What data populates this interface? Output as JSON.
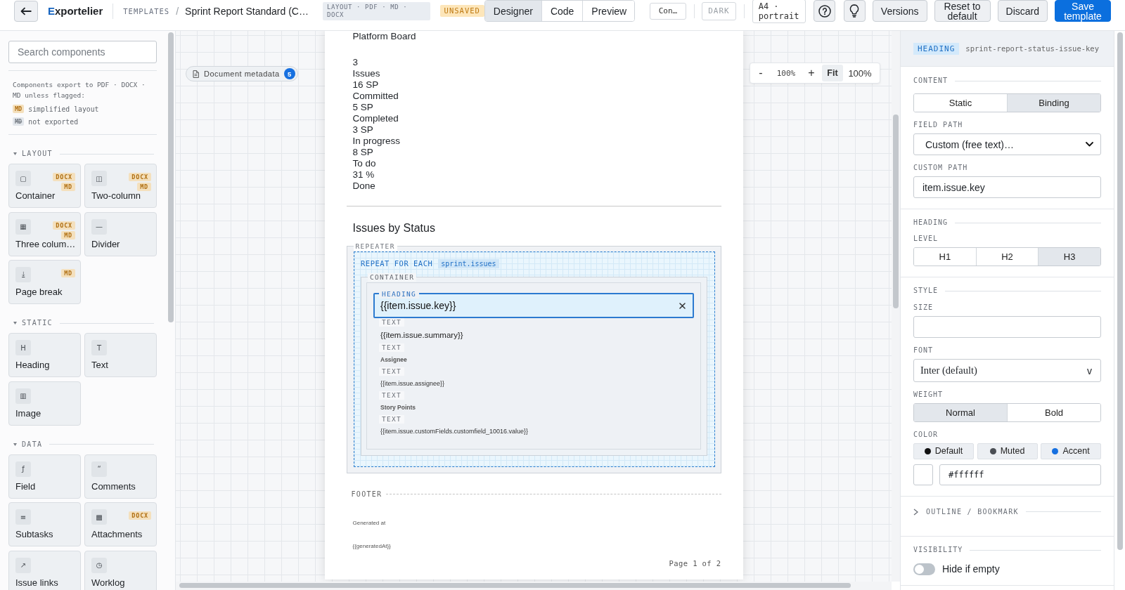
{
  "top_bar": {
    "brand": "Exportelier",
    "breadcrumb": {
      "section": "TEMPLATES",
      "separator": "/",
      "title": "Sprint Report Standard (C…"
    },
    "formats_badge": "LAYOUT · PDF · MD · DOCX",
    "status_badge": "UNSAVED",
    "view_tabs": [
      {
        "label": "Designer",
        "selected": true
      },
      {
        "label": "Code",
        "selected": false
      },
      {
        "label": "Preview",
        "selected": false
      }
    ],
    "context_button": "Con…",
    "theme_toggle": {
      "label": "DARK",
      "on": false
    },
    "page_format": "A4 · portrait",
    "actions": [
      {
        "label": "Versions",
        "kind": "secondary"
      },
      {
        "label": "Reset to default",
        "kind": "secondary"
      },
      {
        "label": "Discard",
        "kind": "secondary"
      },
      {
        "label": "Save template",
        "kind": "primary"
      }
    ]
  },
  "sidebar": {
    "search": {
      "placeholder": "Search components"
    },
    "legend": {
      "note": "Components export to PDF · DOCX · MD unless flagged:",
      "items": [
        {
          "badge": "MD",
          "label": "simplified layout",
          "kind": "simplified"
        },
        {
          "badge": "MD",
          "label": "not exported",
          "kind": "excluded"
        }
      ]
    },
    "groups": [
      {
        "title": "LAYOUT",
        "expanded": true,
        "items": [
          {
            "label": "Container",
            "icon": "▢",
            "flags": [
              "DOCX",
              "MD"
            ]
          },
          {
            "label": "Two-column",
            "icon": "◫",
            "flags": [
              "DOCX",
              "MD"
            ]
          },
          {
            "label": "Three colum…",
            "icon": "▦",
            "flags": [
              "DOCX",
              "MD"
            ]
          },
          {
            "label": "Divider",
            "icon": "—"
          },
          {
            "label": "Page break",
            "icon": "⤓",
            "flags": [
              "MD"
            ]
          }
        ]
      },
      {
        "title": "STATIC",
        "expanded": true,
        "items": [
          {
            "label": "Heading",
            "icon": "H"
          },
          {
            "label": "Text",
            "icon": "T"
          },
          {
            "label": "Image",
            "icon": "▥"
          }
        ]
      },
      {
        "title": "DATA",
        "expanded": true,
        "items": [
          {
            "label": "Field",
            "icon": "ƒ"
          },
          {
            "label": "Comments",
            "icon": "“"
          },
          {
            "label": "Subtasks",
            "icon": "≡"
          },
          {
            "label": "Attachments",
            "icon": "▩",
            "flags": [
              "DOCX"
            ]
          },
          {
            "label": "Issue links",
            "icon": "↗"
          },
          {
            "label": "Worklog",
            "icon": "◷"
          }
        ]
      }
    ]
  },
  "canvas": {
    "metadata_chip": {
      "label": "Document metadata",
      "count": "5"
    },
    "zoom": {
      "zoom_out": "-",
      "level": "100%",
      "zoom_in": "+",
      "modes": [
        {
          "label": "Fit",
          "selected": true
        },
        {
          "label": "100%",
          "selected": false
        }
      ]
    },
    "page": {
      "board": "Platform Board",
      "summary_lines": [
        "3",
        "Issues",
        "16 SP",
        "Committed",
        "5 SP",
        "Completed",
        "3 SP",
        "In progress",
        "8 SP",
        "To do",
        "31 %",
        "Done"
      ],
      "section_title": "Issues by Status",
      "repeater": {
        "label": "REPEATER",
        "loop_label": "REPEAT FOR EACH",
        "source": "sprint.issues",
        "container_label": "CONTAINER",
        "blocks": [
          {
            "kind": "heading",
            "label": "HEADING",
            "text": "{{item.issue.key}}",
            "selected": true
          },
          {
            "kind": "body",
            "label": "TEXT",
            "text": "{{item.issue.summary}}",
            "selected": false
          },
          {
            "kind": "caption",
            "label": "TEXT",
            "text": "Assignee",
            "selected": false
          },
          {
            "kind": "small",
            "label": "TEXT",
            "text": "{{item.issue.assignee}}",
            "selected": false
          },
          {
            "kind": "caption",
            "label": "TEXT",
            "text": "Story Points",
            "selected": false
          },
          {
            "kind": "small",
            "label": "TEXT",
            "text": "{{item.issue.customFields.customfield_10016.value}}",
            "selected": false
          }
        ]
      },
      "footer": {
        "label": "FOOTER",
        "lines": [
          "Generated at",
          "{{generatedAt}}"
        ],
        "page_number": "Page 1 of 2"
      }
    }
  },
  "inspector": {
    "type_badge": "HEADING",
    "element_id": "sprint-report-status-issue-key",
    "content": {
      "title": "CONTENT",
      "modes": [
        {
          "label": "Static",
          "selected": false
        },
        {
          "label": "Binding",
          "selected": true
        }
      ],
      "field_path": {
        "label": "FIELD PATH",
        "value": "Custom (free text)…"
      },
      "custom_path": {
        "label": "CUSTOM PATH",
        "value": "item.issue.key"
      }
    },
    "heading": {
      "title": "HEADING",
      "level_label": "LEVEL",
      "levels": [
        {
          "label": "H1",
          "selected": false
        },
        {
          "label": "H2",
          "selected": false
        },
        {
          "label": "H3",
          "selected": true
        }
      ]
    },
    "style": {
      "title": "STYLE",
      "size": {
        "label": "SIZE"
      },
      "font": {
        "label": "FONT",
        "value": "Inter (default)",
        "caret": "v"
      },
      "weight": {
        "label": "WEIGHT",
        "options": [
          {
            "label": "Normal",
            "selected": true
          },
          {
            "label": "Bold",
            "selected": false
          }
        ]
      },
      "color": {
        "label": "COLOR",
        "presets": [
          {
            "label": "Default",
            "color": "#111111"
          },
          {
            "label": "Muted",
            "color": "#4a4e54"
          },
          {
            "label": "Accent",
            "color": "#1670e0"
          }
        ],
        "custom": {
          "value": "#ffffff"
        }
      }
    },
    "outline": {
      "title": "OUTLINE / BOOKMARK",
      "expanded": false
    },
    "visibility": {
      "title": "VISIBILITY",
      "hide_if_empty": {
        "label": "Hide if empty",
        "on": false
      }
    }
  }
}
